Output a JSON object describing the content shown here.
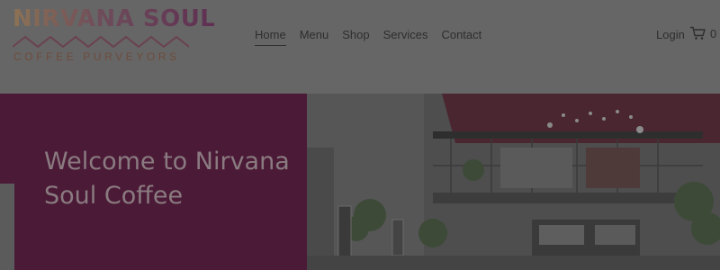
{
  "brand": {
    "name": "NIRVANA SOUL",
    "tagline": "COFFEE PURVEYORS"
  },
  "nav": {
    "items": [
      {
        "label": "Home",
        "active": true
      },
      {
        "label": "Menu"
      },
      {
        "label": "Shop"
      },
      {
        "label": "Services"
      },
      {
        "label": "Contact"
      }
    ]
  },
  "header_actions": {
    "login_label": "Login",
    "cart_count": "0",
    "cart_icon": "shopping-cart-icon"
  },
  "hero": {
    "title": "Welcome to Nirvana Soul Coffee"
  },
  "colors": {
    "header_bg": "#666666",
    "hero_band": "#4b1a37",
    "overlay": "rgba(0,0,0,0.6)"
  }
}
